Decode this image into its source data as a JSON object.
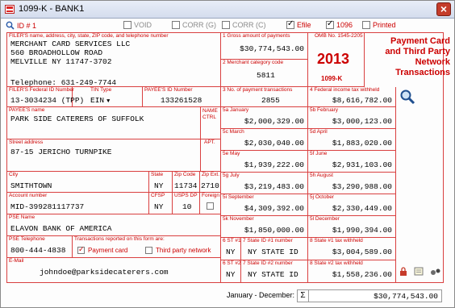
{
  "window": {
    "title": "1099-K - BANK1"
  },
  "toolbar": {
    "id_label": "ID # 1",
    "void_label": "VOID",
    "void_checked": false,
    "corr_g_label": "CORR (G)",
    "corr_g_checked": false,
    "corr_c_label": "CORR (C)",
    "corr_c_checked": false,
    "efile_label": "Efile",
    "efile_checked": true,
    "form1096_label": "1096",
    "form1096_checked": true,
    "printed_label": "Printed",
    "printed_checked": false
  },
  "form": {
    "filer": {
      "caption": "FILER'S name, address, city, state, ZIP code, and telephone number",
      "line1": "MERCHANT CARD SERVICES LLC",
      "line2": "560 BROADHOLLOW ROAD",
      "line3": "MELVILLE NY 11747-3702",
      "phone": "Telephone: 631-249-7744"
    },
    "box1a": {
      "caption": "1 Gross amount of payments",
      "value": "$30,774,543.00"
    },
    "box1b": {
      "caption": "2 Merchant category code",
      "value": "5811"
    },
    "omb": {
      "caption": "OMB No. 1545-2205",
      "year": "2013",
      "form_name": "1099-K"
    },
    "side_title": {
      "line1": "Payment Card",
      "line2": "and Third Party",
      "line3": "Network",
      "line4": "Transactions"
    },
    "filer_tin": {
      "caption": "FILER'S Federal ID Number",
      "value": "13-3034234 (TPP)"
    },
    "tin_type": {
      "caption": "TIN Type",
      "value": "EIN"
    },
    "payee_tin": {
      "caption": "PAYEE'S ID Number",
      "value": "133261528"
    },
    "box3": {
      "caption": "3 No. of payment transactions",
      "value": "2855"
    },
    "box4": {
      "caption": "4 Federal income tax withheld",
      "value": "$8,616,782.00"
    },
    "payee_name": {
      "caption": "PAYEE'S name",
      "value": "PARK SIDE CATERERS OF SUFFOLK"
    },
    "name_ctrl": {
      "caption1": "NAME",
      "caption2": "CTRL"
    },
    "street": {
      "caption": "Street address",
      "value": "87-15 JERICHO TURNPIKE"
    },
    "apt": {
      "caption": "APT."
    },
    "city": {
      "caption": "City",
      "value": "SMITHTOWN"
    },
    "state": {
      "caption": "State",
      "value": "NY"
    },
    "zip": {
      "caption": "Zip Code",
      "value": "11734"
    },
    "zip_ext": {
      "caption": "Zip Ext.",
      "value": "2710"
    },
    "account": {
      "caption": "Account number",
      "value": "MID-399281117737"
    },
    "cfsp": {
      "caption": "CFSP",
      "value": "NY"
    },
    "usps": {
      "caption": "USPS DP",
      "value": "10"
    },
    "foreign": {
      "caption": "Foreign",
      "checked": false
    },
    "pse_name": {
      "caption": "PSE Name",
      "value": "ELAVON BANK OF AMERICA"
    },
    "pse_phone": {
      "caption": "PSE Telephone",
      "value": "800-444-4838"
    },
    "reported": {
      "caption": "Transactions reported on this form are:",
      "payment_card": "Payment card",
      "payment_card_checked": true,
      "third_party": "Third party network",
      "third_party_checked": false
    },
    "email": {
      "caption": "E-Mail",
      "value": "johndoe@parksidecaterers.com"
    },
    "months": [
      {
        "caption": "5a January",
        "value": "$2,000,329.00"
      },
      {
        "caption": "5b February",
        "value": "$3,000,123.00"
      },
      {
        "caption": "5c March",
        "value": "$2,030,040.00"
      },
      {
        "caption": "5d April",
        "value": "$1,883,020.00"
      },
      {
        "caption": "5e May",
        "value": "$1,939,222.00"
      },
      {
        "caption": "5f June",
        "value": "$2,931,103.00"
      },
      {
        "caption": "5g July",
        "value": "$3,219,483.00"
      },
      {
        "caption": "5h August",
        "value": "$3,290,988.00"
      },
      {
        "caption": "5i September",
        "value": "$4,309,392.00"
      },
      {
        "caption": "5j October",
        "value": "$2,330,449.00"
      },
      {
        "caption": "5k November",
        "value": "$1,850,000.00"
      },
      {
        "caption": "5l December",
        "value": "$1,990,394.00"
      }
    ],
    "state_rows": [
      {
        "st_caption": "6 ST #1",
        "st": "NY",
        "id_caption": "7 State ID #1 number",
        "id": "NY STATE ID",
        "tax_caption": "8 State #1 tax withheld",
        "tax": "$3,004,589.00"
      },
      {
        "st_caption": "6 ST #2",
        "st": "NY",
        "id_caption": "7 State ID #2 number",
        "id": "NY STATE ID",
        "tax_caption": "8 State #2 tax withheld",
        "tax": "$1,558,236.00"
      }
    ]
  },
  "footer": {
    "label": "January - December:",
    "sigma": "Σ",
    "total": "$30,774,543.00"
  },
  "colors": {
    "accent_red": "#cc0000",
    "border_red": "#d94040"
  }
}
